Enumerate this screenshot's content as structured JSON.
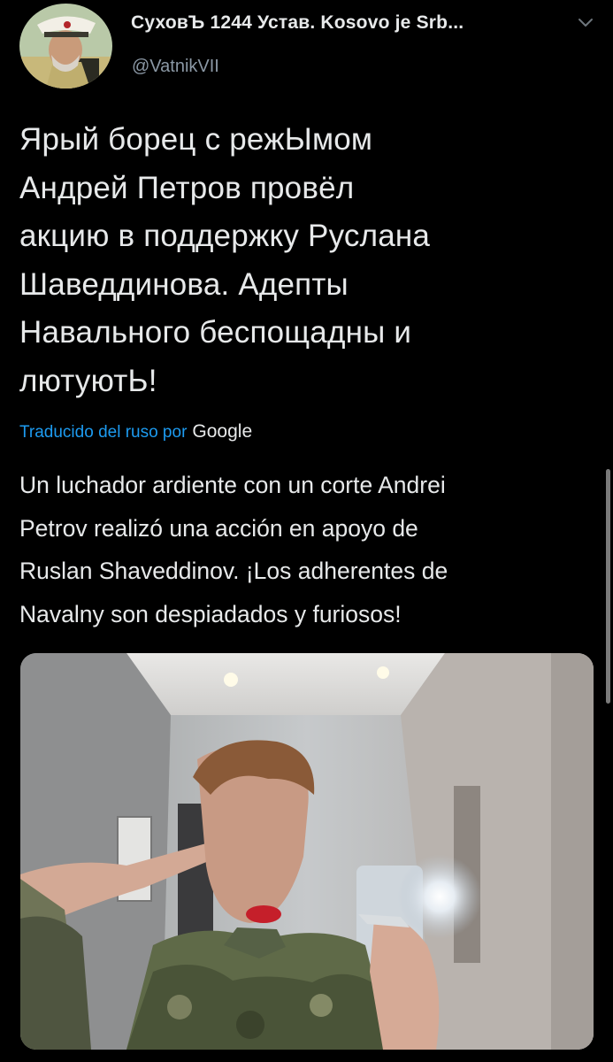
{
  "tweet": {
    "display_name": "СуховЪ 1244 Устав. Kosovo je Srb...",
    "handle": "@VatnikVII",
    "text": "Ярый борец с режЫмом\nАндрей Петров провёл\nакцию в поддержку Руслана\nШаведдинова. Адепты\nНавального беспощадны и\nлютуютЬ!",
    "translated_by": "Traducido del ruso por",
    "translator": "Google",
    "translation": "Un luchador ardiente con un corte Andrei\nPetrov realizó una acción en apoyo de\nRuslan Shaveddinov. ¡Los adherentes de\nNavalny son despiadados y furiosos!"
  },
  "icons": {
    "menu": "chevron-down-icon",
    "avatar": "profile-avatar"
  },
  "colors": {
    "background": "#000000",
    "primary_text": "#e7e9ea",
    "secondary_text": "#8b98a5",
    "link": "#1d9bf0"
  }
}
